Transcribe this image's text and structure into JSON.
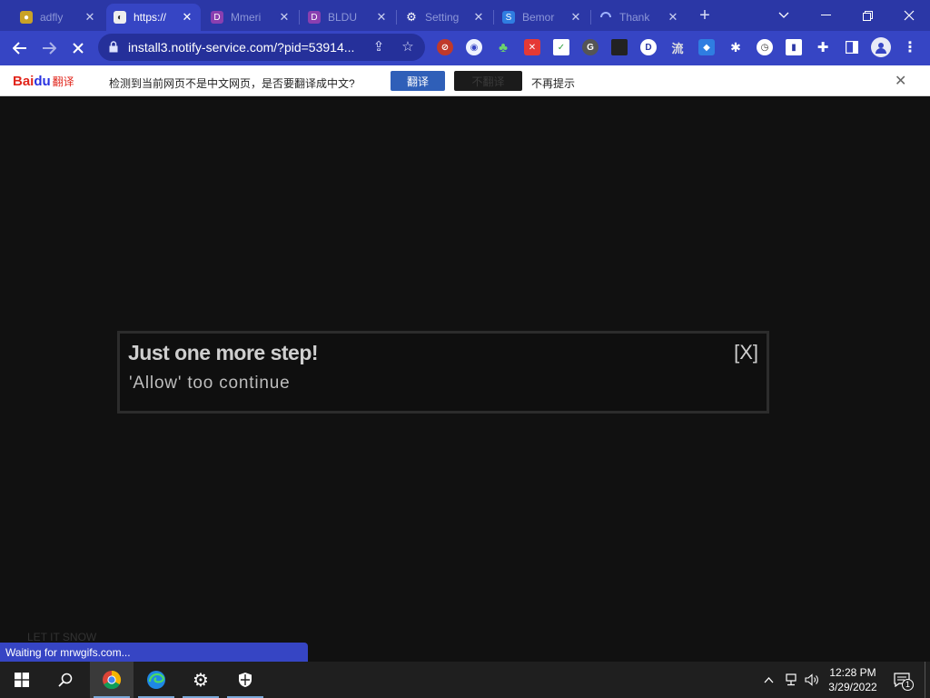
{
  "tabs": [
    {
      "label": "adfly",
      "active": false
    },
    {
      "label": "https://",
      "active": true
    },
    {
      "label": "Mmeri",
      "active": false
    },
    {
      "label": "BLDU",
      "active": false
    },
    {
      "label": "Setting",
      "active": false
    },
    {
      "label": "Bemor",
      "active": false
    },
    {
      "label": "Thank",
      "active": false
    }
  ],
  "toolbar": {
    "url": "install3.notify-service.com/?pid=53914..."
  },
  "extensions": [
    "G",
    "D",
    "流"
  ],
  "translate_bar": {
    "brand_bai": "Bai",
    "brand_du": "du",
    "brand_translate": "翻译",
    "message": "检测到当前网页不是中文网页，是否要翻译成中文?",
    "translate_button": "翻译",
    "no_translate_button": "不翻译",
    "never_label": "不再提示"
  },
  "page": {
    "dialog_title": "Just one more step!",
    "dialog_subtitle": "'Allow' too continue",
    "dialog_close": "[X]",
    "footer_text": "LET IT SNOW"
  },
  "status_bar": {
    "text": "Waiting for mrwgifs.com..."
  },
  "taskbar": {
    "time": "12:28 PM",
    "date": "3/29/2022",
    "notification_count": "1"
  },
  "colors": {
    "titlebar": "#2b37a6",
    "toolbar": "#3645c4",
    "omnibox": "#25309a",
    "page_bg": "#111111",
    "translate_button": "#2f5fb8"
  }
}
